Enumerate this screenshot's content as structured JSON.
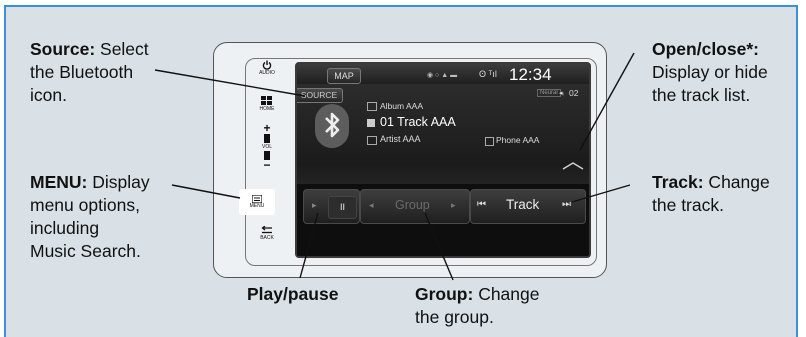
{
  "callouts": {
    "source_title": "Source:",
    "source_l1": " Select",
    "source_l2": "the Bluetooth",
    "source_l3": "icon.",
    "menu_title": "MENU:",
    "menu_l1": " Display",
    "menu_l2": "menu options,",
    "menu_l3": "including",
    "menu_l4": "Music Search.",
    "play_pause": "Play/pause",
    "group_title": "Group:",
    "group_l1": " Change",
    "group_l2": "the group.",
    "open_title": "Open/close*:",
    "open_l1": "Display or hide",
    "open_l2": "the track list.",
    "track_title": "Track:",
    "track_l1": " Change",
    "track_l2": "the track."
  },
  "side_buttons": {
    "audio": "AUDIO",
    "home": "HOME",
    "vol": "VOL",
    "menu": "MENU",
    "back": "BACK"
  },
  "screen": {
    "map_button": "MAP",
    "source_button": "SOURCE",
    "clock": "12:34",
    "neural": "Neural",
    "station_num": "02",
    "album": "Album AAA",
    "track": "01 Track AAA",
    "artist": "Artist AAA",
    "phone": "Phone AAA",
    "group_label": "Group",
    "track_label": "Track"
  },
  "colors": {
    "panel_bg": "#d9e1e6",
    "panel_border": "#3c8fd6",
    "screen_bg": "#151515"
  }
}
